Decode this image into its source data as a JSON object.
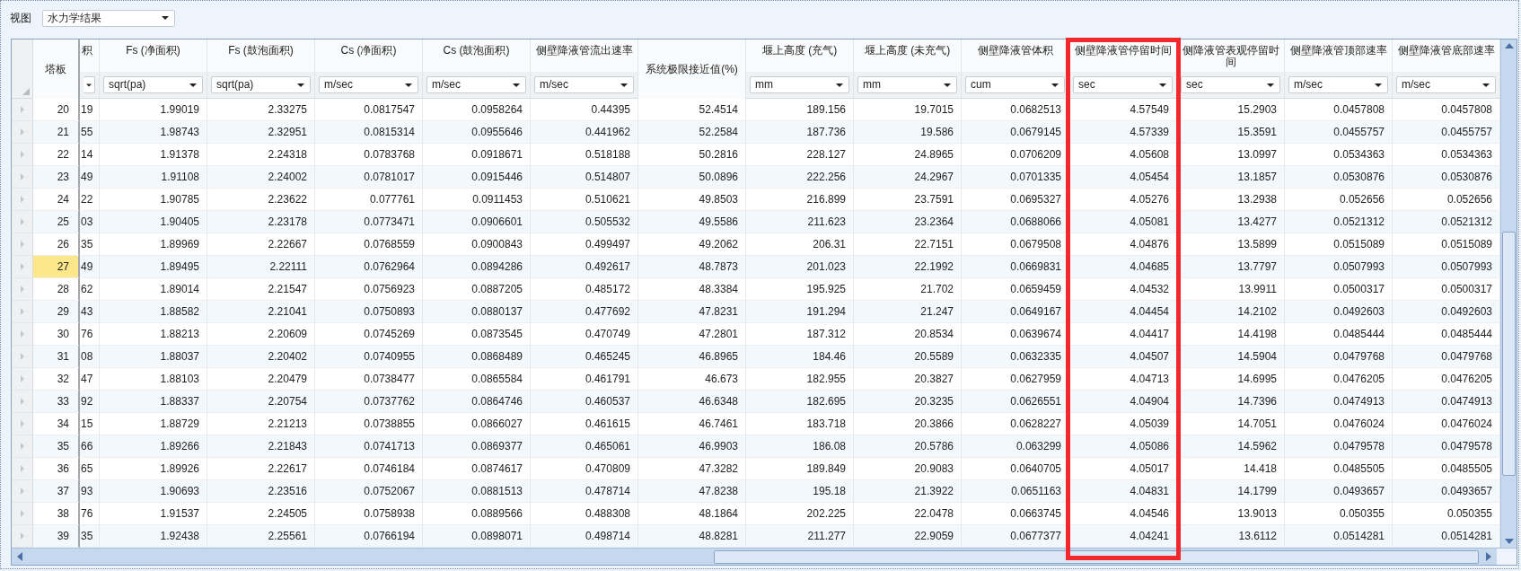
{
  "toolbar": {
    "label": "视图",
    "view_dropdown": "水力学结果"
  },
  "row_header_title": "塔板",
  "columns": [
    {
      "kind": "partial",
      "title": "积"
    },
    {
      "kind": "unit",
      "title": "Fs (净面积)",
      "unit": "sqrt(pa)",
      "highlighted": false
    },
    {
      "kind": "unit",
      "title": "Fs (鼓泡面积)",
      "unit": "sqrt(pa)",
      "highlighted": false
    },
    {
      "kind": "unit",
      "title": "Cs (净面积)",
      "unit": "m/sec",
      "highlighted": false
    },
    {
      "kind": "unit",
      "title": "Cs (鼓泡面积)",
      "unit": "m/sec",
      "highlighted": false
    },
    {
      "kind": "unit",
      "title": "侧壁降液管流出速率",
      "unit": "m/sec",
      "highlighted": false
    },
    {
      "kind": "plain",
      "title": "系统极限接近值(%)",
      "highlighted": false
    },
    {
      "kind": "unit",
      "title": "堰上高度 (充气)",
      "unit": "mm",
      "highlighted": false
    },
    {
      "kind": "unit",
      "title": "堰上高度 (未充气)",
      "unit": "mm",
      "highlighted": false
    },
    {
      "kind": "unit",
      "title": "侧壁降液管体积",
      "unit": "cum",
      "highlighted": false
    },
    {
      "kind": "unit",
      "title": "侧壁降液管停留时间",
      "unit": "sec",
      "highlighted": true
    },
    {
      "kind": "unit",
      "title": "侧降液管表观停留时间",
      "unit": "sec",
      "highlighted": false
    },
    {
      "kind": "unit",
      "title": "侧壁降液管顶部速率",
      "unit": "m/sec",
      "highlighted": false
    },
    {
      "kind": "unit",
      "title": "侧壁降液管底部速率",
      "unit": "m/sec",
      "highlighted": false
    }
  ],
  "rows": [
    {
      "tray": "20",
      "selected": false,
      "cells": [
        "19",
        "1.99019",
        "2.33275",
        "0.0817547",
        "0.0958264",
        "0.44395",
        "52.4514",
        "189.156",
        "19.7015",
        "0.0682513",
        "4.57549",
        "15.2903",
        "0.0457808",
        "0.0457808"
      ]
    },
    {
      "tray": "21",
      "selected": false,
      "cells": [
        "55",
        "1.98743",
        "2.32951",
        "0.0815314",
        "0.0955646",
        "0.441962",
        "52.2584",
        "187.736",
        "19.586",
        "0.0679145",
        "4.57339",
        "15.3591",
        "0.0455757",
        "0.0455757"
      ]
    },
    {
      "tray": "22",
      "selected": false,
      "cells": [
        "14",
        "1.91378",
        "2.24318",
        "0.0783768",
        "0.0918671",
        "0.518188",
        "50.2816",
        "228.127",
        "24.8965",
        "0.0706209",
        "4.05608",
        "13.0997",
        "0.0534363",
        "0.0534363"
      ]
    },
    {
      "tray": "23",
      "selected": false,
      "cells": [
        "49",
        "1.91108",
        "2.24002",
        "0.0781017",
        "0.0915446",
        "0.514807",
        "50.0896",
        "222.256",
        "24.2967",
        "0.0701335",
        "4.05454",
        "13.1857",
        "0.0530876",
        "0.0530876"
      ]
    },
    {
      "tray": "24",
      "selected": false,
      "cells": [
        "22",
        "1.90785",
        "2.23622",
        "0.077761",
        "0.0911453",
        "0.510621",
        "49.8503",
        "216.899",
        "23.7591",
        "0.0695327",
        "4.05276",
        "13.2938",
        "0.052656",
        "0.052656"
      ]
    },
    {
      "tray": "25",
      "selected": false,
      "cells": [
        "03",
        "1.90405",
        "2.23178",
        "0.0773471",
        "0.0906601",
        "0.505532",
        "49.5586",
        "211.623",
        "23.2364",
        "0.0688066",
        "4.05081",
        "13.4277",
        "0.0521312",
        "0.0521312"
      ]
    },
    {
      "tray": "26",
      "selected": false,
      "cells": [
        "35",
        "1.89969",
        "2.22667",
        "0.0768559",
        "0.0900843",
        "0.499497",
        "49.2062",
        "206.31",
        "22.7151",
        "0.0679508",
        "4.04876",
        "13.5899",
        "0.0515089",
        "0.0515089"
      ]
    },
    {
      "tray": "27",
      "selected": true,
      "cells": [
        "49",
        "1.89495",
        "2.22111",
        "0.0762964",
        "0.0894286",
        "0.492617",
        "48.7873",
        "201.023",
        "22.1992",
        "0.0669831",
        "4.04685",
        "13.7797",
        "0.0507993",
        "0.0507993"
      ]
    },
    {
      "tray": "28",
      "selected": false,
      "cells": [
        "62",
        "1.89014",
        "2.21547",
        "0.0756923",
        "0.0887205",
        "0.485172",
        "48.3384",
        "195.925",
        "21.702",
        "0.0659459",
        "4.04532",
        "13.9911",
        "0.0500317",
        "0.0500317"
      ]
    },
    {
      "tray": "29",
      "selected": false,
      "cells": [
        "43",
        "1.88582",
        "2.21041",
        "0.0750893",
        "0.0880137",
        "0.477692",
        "47.8231",
        "191.294",
        "21.247",
        "0.0649167",
        "4.04454",
        "14.2102",
        "0.0492603",
        "0.0492603"
      ]
    },
    {
      "tray": "30",
      "selected": false,
      "cells": [
        "76",
        "1.88213",
        "2.20609",
        "0.0745269",
        "0.0873545",
        "0.470749",
        "47.2801",
        "187.312",
        "20.8534",
        "0.0639674",
        "4.04417",
        "14.4198",
        "0.0485444",
        "0.0485444"
      ]
    },
    {
      "tray": "31",
      "selected": false,
      "cells": [
        "08",
        "1.88037",
        "2.20402",
        "0.0740955",
        "0.0868489",
        "0.465245",
        "46.8965",
        "184.46",
        "20.5589",
        "0.0632335",
        "4.04507",
        "14.5904",
        "0.0479768",
        "0.0479768"
      ]
    },
    {
      "tray": "32",
      "selected": false,
      "cells": [
        "47",
        "1.88103",
        "2.20479",
        "0.0738477",
        "0.0865584",
        "0.461791",
        "46.673",
        "182.955",
        "20.3827",
        "0.0627959",
        "4.04713",
        "14.6995",
        "0.0476205",
        "0.0476205"
      ]
    },
    {
      "tray": "33",
      "selected": false,
      "cells": [
        "92",
        "1.88337",
        "2.20754",
        "0.0737762",
        "0.0864746",
        "0.460537",
        "46.6348",
        "182.695",
        "20.3235",
        "0.0626551",
        "4.04904",
        "14.7396",
        "0.0474913",
        "0.0474913"
      ]
    },
    {
      "tray": "34",
      "selected": false,
      "cells": [
        "15",
        "1.88729",
        "2.21213",
        "0.0738855",
        "0.0866027",
        "0.461615",
        "46.7461",
        "183.718",
        "20.3866",
        "0.0628227",
        "4.05039",
        "14.7051",
        "0.0476024",
        "0.0476024"
      ]
    },
    {
      "tray": "35",
      "selected": false,
      "cells": [
        "66",
        "1.89266",
        "2.21843",
        "0.0741713",
        "0.0869377",
        "0.465061",
        "46.9903",
        "186.08",
        "20.5786",
        "0.063299",
        "4.05086",
        "14.5962",
        "0.0479578",
        "0.0479578"
      ]
    },
    {
      "tray": "36",
      "selected": false,
      "cells": [
        "65",
        "1.89926",
        "2.22617",
        "0.0746184",
        "0.0874617",
        "0.470809",
        "47.3282",
        "189.849",
        "20.9083",
        "0.0640705",
        "4.05017",
        "14.418",
        "0.0485505",
        "0.0485505"
      ]
    },
    {
      "tray": "37",
      "selected": false,
      "cells": [
        "93",
        "1.90693",
        "2.23516",
        "0.0752067",
        "0.0881513",
        "0.478714",
        "47.8238",
        "195.18",
        "21.3922",
        "0.0651163",
        "4.04831",
        "14.1799",
        "0.0493657",
        "0.0493657"
      ]
    },
    {
      "tray": "38",
      "selected": false,
      "cells": [
        "76",
        "1.91537",
        "2.24505",
        "0.0758938",
        "0.0889566",
        "0.488308",
        "48.1864",
        "202.225",
        "22.0478",
        "0.0663745",
        "4.04546",
        "13.9013",
        "0.050355",
        "0.050355"
      ]
    },
    {
      "tray": "39",
      "selected": false,
      "cells": [
        "35",
        "1.92438",
        "2.25561",
        "0.0766194",
        "0.0898071",
        "0.498714",
        "48.8281",
        "211.277",
        "22.9059",
        "0.0677377",
        "4.04241",
        "13.6112",
        "0.0514281",
        "0.0514281"
      ]
    }
  ]
}
